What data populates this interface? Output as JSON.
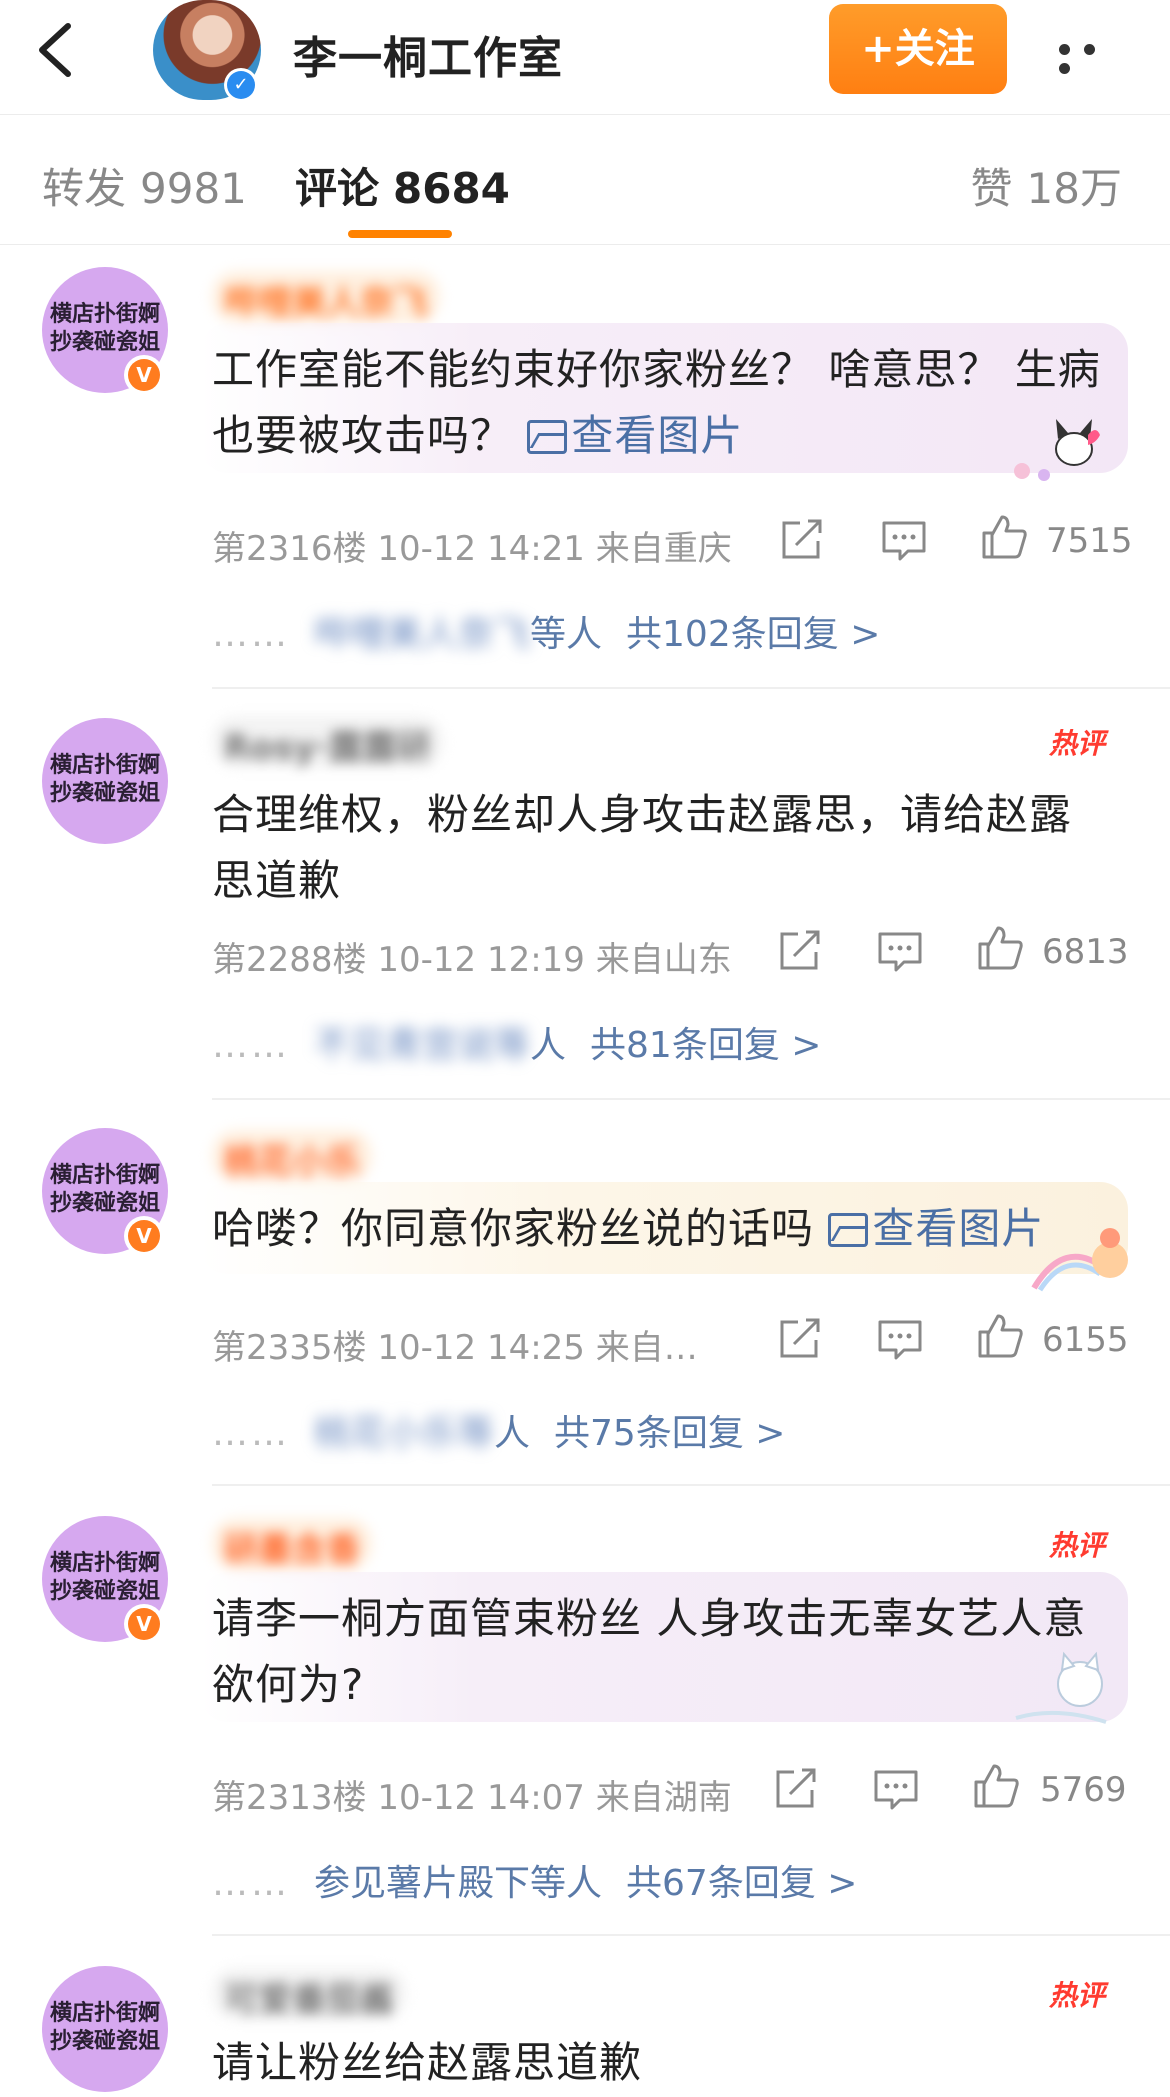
{
  "header": {
    "title": "李一桐工作室",
    "follow_label": "+关注"
  },
  "tabs": {
    "repost_label": "转发",
    "repost_count": "9981",
    "comment_label": "评论",
    "comment_count": "8684",
    "like_label": "赞",
    "like_count": "18万"
  },
  "colors": {
    "accent": "#ff8200",
    "link": "#5a7aa8",
    "hot": "#ff3b30"
  },
  "comments": [
    {
      "avatar_text": [
        "横店扑街婀",
        "抄袭碰瓷姐"
      ],
      "username": "哔哩美人奈飞",
      "hot": "",
      "text": "工作室能不能约束好你家粉丝？ 啥意思？ 生病也要被攻击吗？ ",
      "view_image": "查看图片",
      "meta": "第2316楼 10-12 14:21 来自重庆",
      "likes": "7515",
      "reply_users": "哔哩美人奈飞",
      "reply_suffix": "等人",
      "reply_total": "共102条回复 >"
    },
    {
      "avatar_text": [
        "横店扑街婀",
        "抄袭碰瓷姐"
      ],
      "username": "Rosy·露露研",
      "hot": "热评",
      "text": "合理维权，粉丝却人身攻击赵露思，请给赵露思道歉",
      "view_image": "",
      "meta": "第2288楼 10-12 12:19 来自山东",
      "likes": "6813",
      "reply_users": "不见青宫说等",
      "reply_suffix": "人",
      "reply_total": "共81条回复 >"
    },
    {
      "avatar_text": [
        "横店扑街婀",
        "抄袭碰瓷姐"
      ],
      "username": "桃花小乐",
      "hot": "",
      "text": "哈喽？你同意你家粉丝说的话吗 ",
      "view_image": "查看图片",
      "meta": "第2335楼 10-12 14:25 来自…",
      "likes": "6155",
      "reply_users": "桃花小乐等",
      "reply_suffix": "人",
      "reply_total": "共75条回复 >"
    },
    {
      "avatar_text": [
        "横店扑街婀",
        "抄袭碰瓷姐"
      ],
      "username": "研墨含香",
      "hot": "热评",
      "text": "请李一桐方面管束粉丝 人身攻击无辜女艺人意欲何为?",
      "view_image": "",
      "meta": "第2313楼 10-12 14:07 来自湖南",
      "likes": "5769",
      "reply_users": "参见薯片殿下",
      "reply_suffix": "等人",
      "reply_total": "共67条回复 >"
    },
    {
      "avatar_text": [
        "横店扑街婀",
        "抄袭碰瓷姐"
      ],
      "username": "可爱番茄酱",
      "hot": "热评",
      "text": "请让粉丝给赵露思道歉",
      "view_image": "",
      "meta": "",
      "likes": "",
      "reply_users": "",
      "reply_suffix": "",
      "reply_total": ""
    }
  ]
}
